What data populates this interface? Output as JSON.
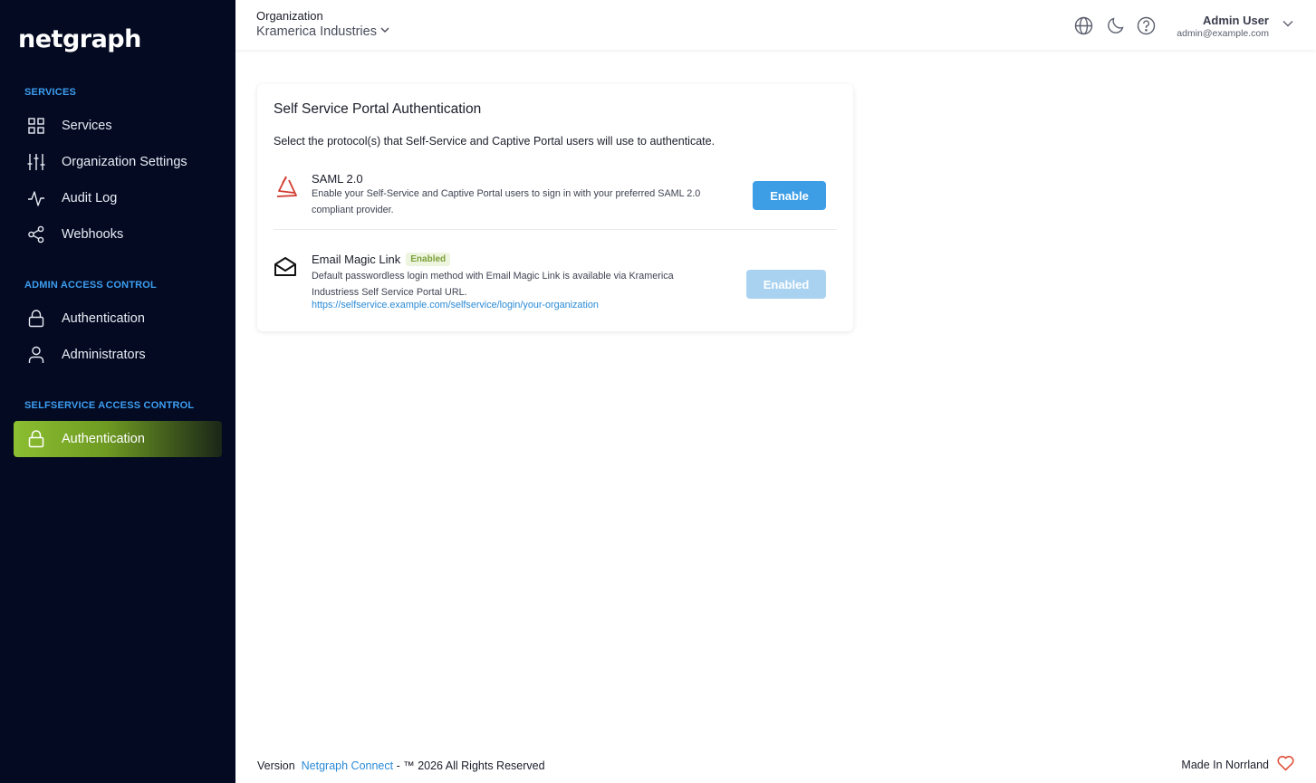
{
  "sidebar": {
    "logo": "netgraph",
    "sections": {
      "services": "SERVICES",
      "admin": "ADMIN ACCESS CONTROL",
      "selfservice": "SELFSERVICE ACCESS CONTROL"
    },
    "items": {
      "services": "Services",
      "org_settings": "Organization Settings",
      "audit_log": "Audit Log",
      "webhooks": "Webhooks",
      "admin_auth": "Authentication",
      "administrators": "Administrators",
      "ss_auth": "Authentication"
    }
  },
  "header": {
    "org_label": "Organization",
    "org_name": "Kramerica Industries",
    "user_name": "Admin User",
    "user_email": "admin@example.com"
  },
  "card": {
    "title": "Self Service Portal Authentication",
    "description": "Select the protocol(s) that Self-Service and Captive Portal users will use to authenticate.",
    "saml": {
      "name": "SAML 2.0",
      "line1": "Enable your Self-Service and Captive Portal users to sign in with your preferred SAML 2.0",
      "line2": "compliant provider.",
      "button": "Enable"
    },
    "magic": {
      "name": "Email Magic Link",
      "badge": "Enabled",
      "line1": "Default passwordless login method with Email Magic Link is available via Kramerica",
      "line2": "Industriess Self Service Portal URL.",
      "url": "https://selfservice.example.com/selfservice/login/your-organization",
      "button": "Enabled"
    }
  },
  "footer": {
    "version": "Version",
    "product": "Netgraph Connect",
    "rights": "- ™ 2026 All Rights Reserved",
    "made_in": "Made In Norrland"
  },
  "colors": {
    "sidebar_bg": "#030a22",
    "accent_blue": "#3d9ee6",
    "section_blue": "#3d9ef0",
    "active_green": "#8cbf31",
    "heart_red": "#e0533d"
  }
}
